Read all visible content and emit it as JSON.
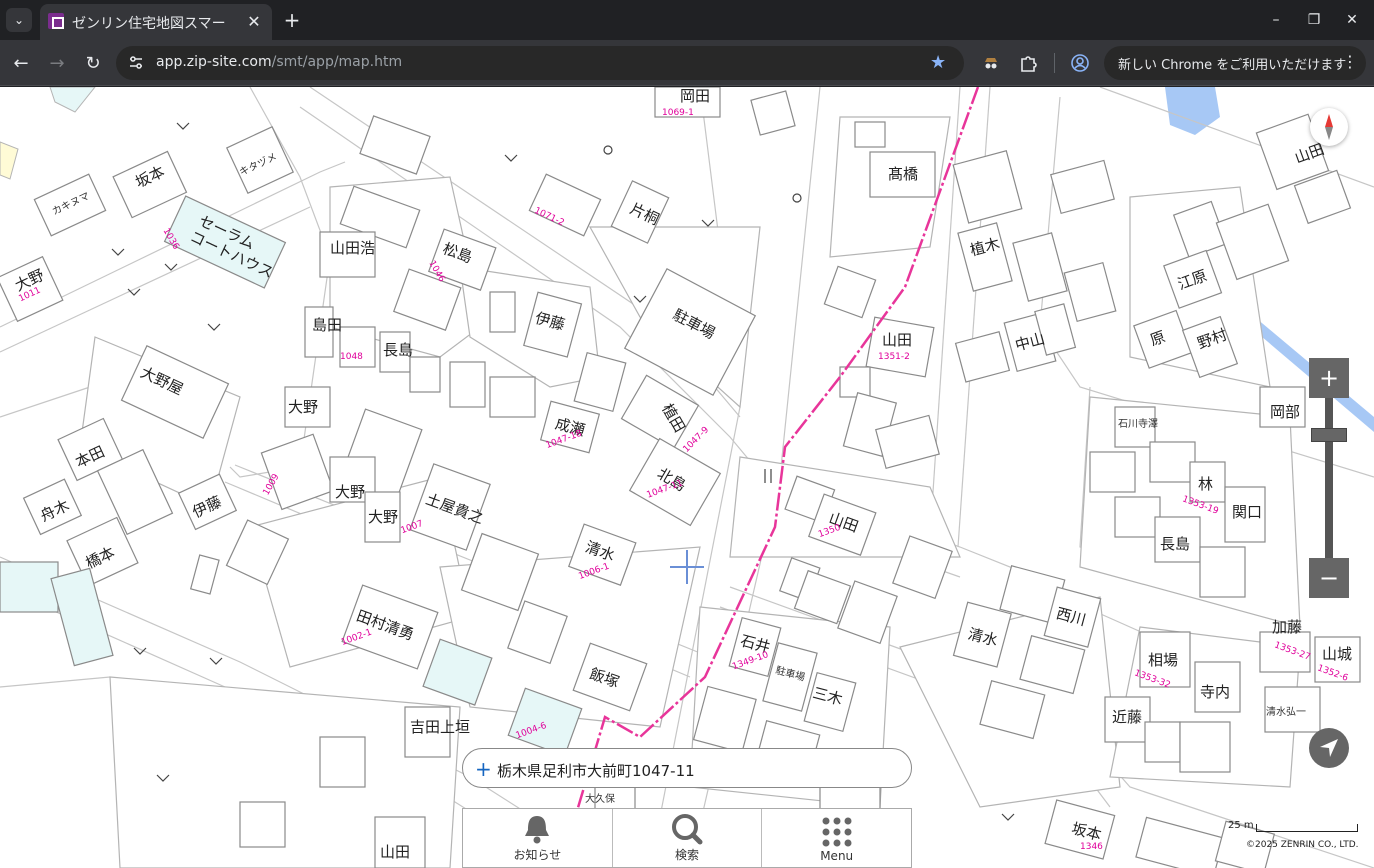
{
  "browser": {
    "tab_title": "ゼンリン住宅地図スマー",
    "url_host": "app.zip-site.com",
    "url_path": "/smt/app/map.htm",
    "update_label": "新しい Chrome をご利用いただけます",
    "icons": {
      "tab_list": "chevron-down-icon",
      "close": "close-icon",
      "new_tab": "plus-icon",
      "back": "arrow-left-icon",
      "forward": "arrow-right-icon",
      "reload": "reload-icon",
      "bookmark": "star-icon",
      "extensions": "puzzle-icon",
      "profile": "profile-icon",
      "menu": "kebab-menu-icon"
    }
  },
  "map": {
    "address": "栃木県足利市大前町1047-11",
    "scale_label": "25 m",
    "copyright": "©2025 ZENRIN CO., LTD.",
    "route_color": "#e8359a",
    "lot_color": "#e0009a",
    "water_color": "#a7c8f5",
    "labels": [
      {
        "id": "okada",
        "text": "岡田"
      },
      {
        "id": "takahashi",
        "text": "髙橋"
      },
      {
        "id": "sakamoto1",
        "text": "坂本"
      },
      {
        "id": "kitazume",
        "text": "キタヅメ"
      },
      {
        "id": "serarum",
        "text": "セーラム"
      },
      {
        "id": "courthouse",
        "text": "コートハウス"
      },
      {
        "id": "oono1",
        "text": "大野"
      },
      {
        "id": "kakinuma",
        "text": "カキヌマ"
      },
      {
        "id": "yamadahiroshi",
        "text": "山田浩"
      },
      {
        "id": "matsushima",
        "text": "松島"
      },
      {
        "id": "katagiri",
        "text": "片桐"
      },
      {
        "id": "parking1",
        "text": "駐車場"
      },
      {
        "id": "shimada",
        "text": "島田"
      },
      {
        "id": "nagashima1",
        "text": "長島"
      },
      {
        "id": "itou1",
        "text": "伊藤"
      },
      {
        "id": "ohnoya",
        "text": "大野屋"
      },
      {
        "id": "oono2",
        "text": "大野"
      },
      {
        "id": "naruse",
        "text": "成瀬"
      },
      {
        "id": "ueda",
        "text": "植田"
      },
      {
        "id": "kitajima",
        "text": "北島"
      },
      {
        "id": "honda",
        "text": "本田"
      },
      {
        "id": "oono3",
        "text": "大野"
      },
      {
        "id": "oono4",
        "text": "大野"
      },
      {
        "id": "tsuchiya",
        "text": "土屋貴之"
      },
      {
        "id": "funaki",
        "text": "舟木"
      },
      {
        "id": "itou2",
        "text": "伊藤"
      },
      {
        "id": "hashimoto",
        "text": "橋本"
      },
      {
        "id": "shimizu1",
        "text": "清水"
      },
      {
        "id": "tamura",
        "text": "田村清勇"
      },
      {
        "id": "yoshida",
        "text": "吉田上垣"
      },
      {
        "id": "yamada1",
        "text": "山田"
      },
      {
        "id": "yamada2",
        "text": "山田"
      },
      {
        "id": "ueki",
        "text": "植木"
      },
      {
        "id": "nakayama",
        "text": "中山"
      },
      {
        "id": "enomoto",
        "text": "江原"
      },
      {
        "id": "hara",
        "text": "原"
      },
      {
        "id": "nomura",
        "text": "野村"
      },
      {
        "id": "okabe",
        "text": "岡部"
      },
      {
        "id": "ishikawa",
        "text": "石川寺澤"
      },
      {
        "id": "hayashi",
        "text": "林"
      },
      {
        "id": "sekiguchi",
        "text": "関口"
      },
      {
        "id": "nagashima2",
        "text": "長島"
      },
      {
        "id": "yamada3",
        "text": "山田"
      },
      {
        "id": "ishii",
        "text": "石井"
      },
      {
        "id": "parking2",
        "text": "駐車場"
      },
      {
        "id": "miki",
        "text": "三木"
      },
      {
        "id": "shimizu2",
        "text": "清水"
      },
      {
        "id": "nishikawa",
        "text": "西川"
      },
      {
        "id": "aiba",
        "text": "相場"
      },
      {
        "id": "teranouchi",
        "text": "寺内"
      },
      {
        "id": "kondo",
        "text": "近藤"
      },
      {
        "id": "kato",
        "text": "加藤"
      },
      {
        "id": "yamashiro",
        "text": "山城"
      },
      {
        "id": "shimizu3",
        "text": "清水弘一"
      },
      {
        "id": "sakamoto2",
        "text": "坂本"
      },
      {
        "id": "yamada4",
        "text": "山田"
      },
      {
        "id": "oozuka",
        "text": "飯塚"
      },
      {
        "id": "ohkubo",
        "text": "大久保"
      }
    ],
    "lots": [
      {
        "id": "l1",
        "text": "1069-1"
      },
      {
        "id": "l2",
        "text": "1071-2"
      },
      {
        "id": "l3",
        "text": "1036"
      },
      {
        "id": "l4",
        "text": "1046"
      },
      {
        "id": "l5",
        "text": "1011"
      },
      {
        "id": "l6",
        "text": "1047-9"
      },
      {
        "id": "l7",
        "text": "1047-11"
      },
      {
        "id": "l8",
        "text": "1047-18"
      },
      {
        "id": "l9",
        "text": "1048"
      },
      {
        "id": "l10",
        "text": "1009"
      },
      {
        "id": "l11",
        "text": "1007"
      },
      {
        "id": "l12",
        "text": "1006-1"
      },
      {
        "id": "l13",
        "text": "1002-1"
      },
      {
        "id": "l14",
        "text": "1004-6"
      },
      {
        "id": "l15",
        "text": "1351-2"
      },
      {
        "id": "l16",
        "text": "1350"
      },
      {
        "id": "l17",
        "text": "1349-10"
      },
      {
        "id": "l18",
        "text": "1353-32"
      },
      {
        "id": "l19",
        "text": "1353-27"
      },
      {
        "id": "l20",
        "text": "1352-6"
      },
      {
        "id": "l21",
        "text": "1346"
      },
      {
        "id": "l22",
        "text": "1353-19"
      }
    ]
  },
  "menu": {
    "notice": "お知らせ",
    "search": "検索",
    "menu": "Menu"
  }
}
